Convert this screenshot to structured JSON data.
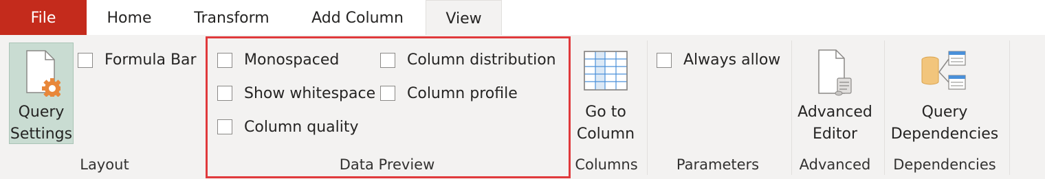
{
  "tabs": {
    "file": "File",
    "home": "Home",
    "transform": "Transform",
    "add_column": "Add Column",
    "view": "View"
  },
  "layout_group": {
    "query_settings": [
      "Query",
      "Settings"
    ],
    "formula_bar": "Formula Bar",
    "label": "Layout"
  },
  "data_preview_group": {
    "monospaced": "Monospaced",
    "show_whitespace": "Show whitespace",
    "column_quality": "Column quality",
    "column_distribution": "Column distribution",
    "column_profile": "Column profile",
    "label": "Data Preview"
  },
  "columns_group": {
    "go_to_column": [
      "Go to",
      "Column"
    ],
    "label": "Columns"
  },
  "parameters_group": {
    "always_allow": "Always allow",
    "label": "Parameters"
  },
  "advanced_group": {
    "advanced_editor": [
      "Advanced",
      "Editor"
    ],
    "label": "Advanced"
  },
  "dependencies_group": {
    "query_dependencies": [
      "Query",
      "Dependencies"
    ],
    "label": "Dependencies"
  },
  "colors": {
    "file_tab": "#c42b1c",
    "highlight_border": "#e0393b",
    "query_settings_selected": "#c9dcd2",
    "checkbox_border": "#8a8886"
  }
}
